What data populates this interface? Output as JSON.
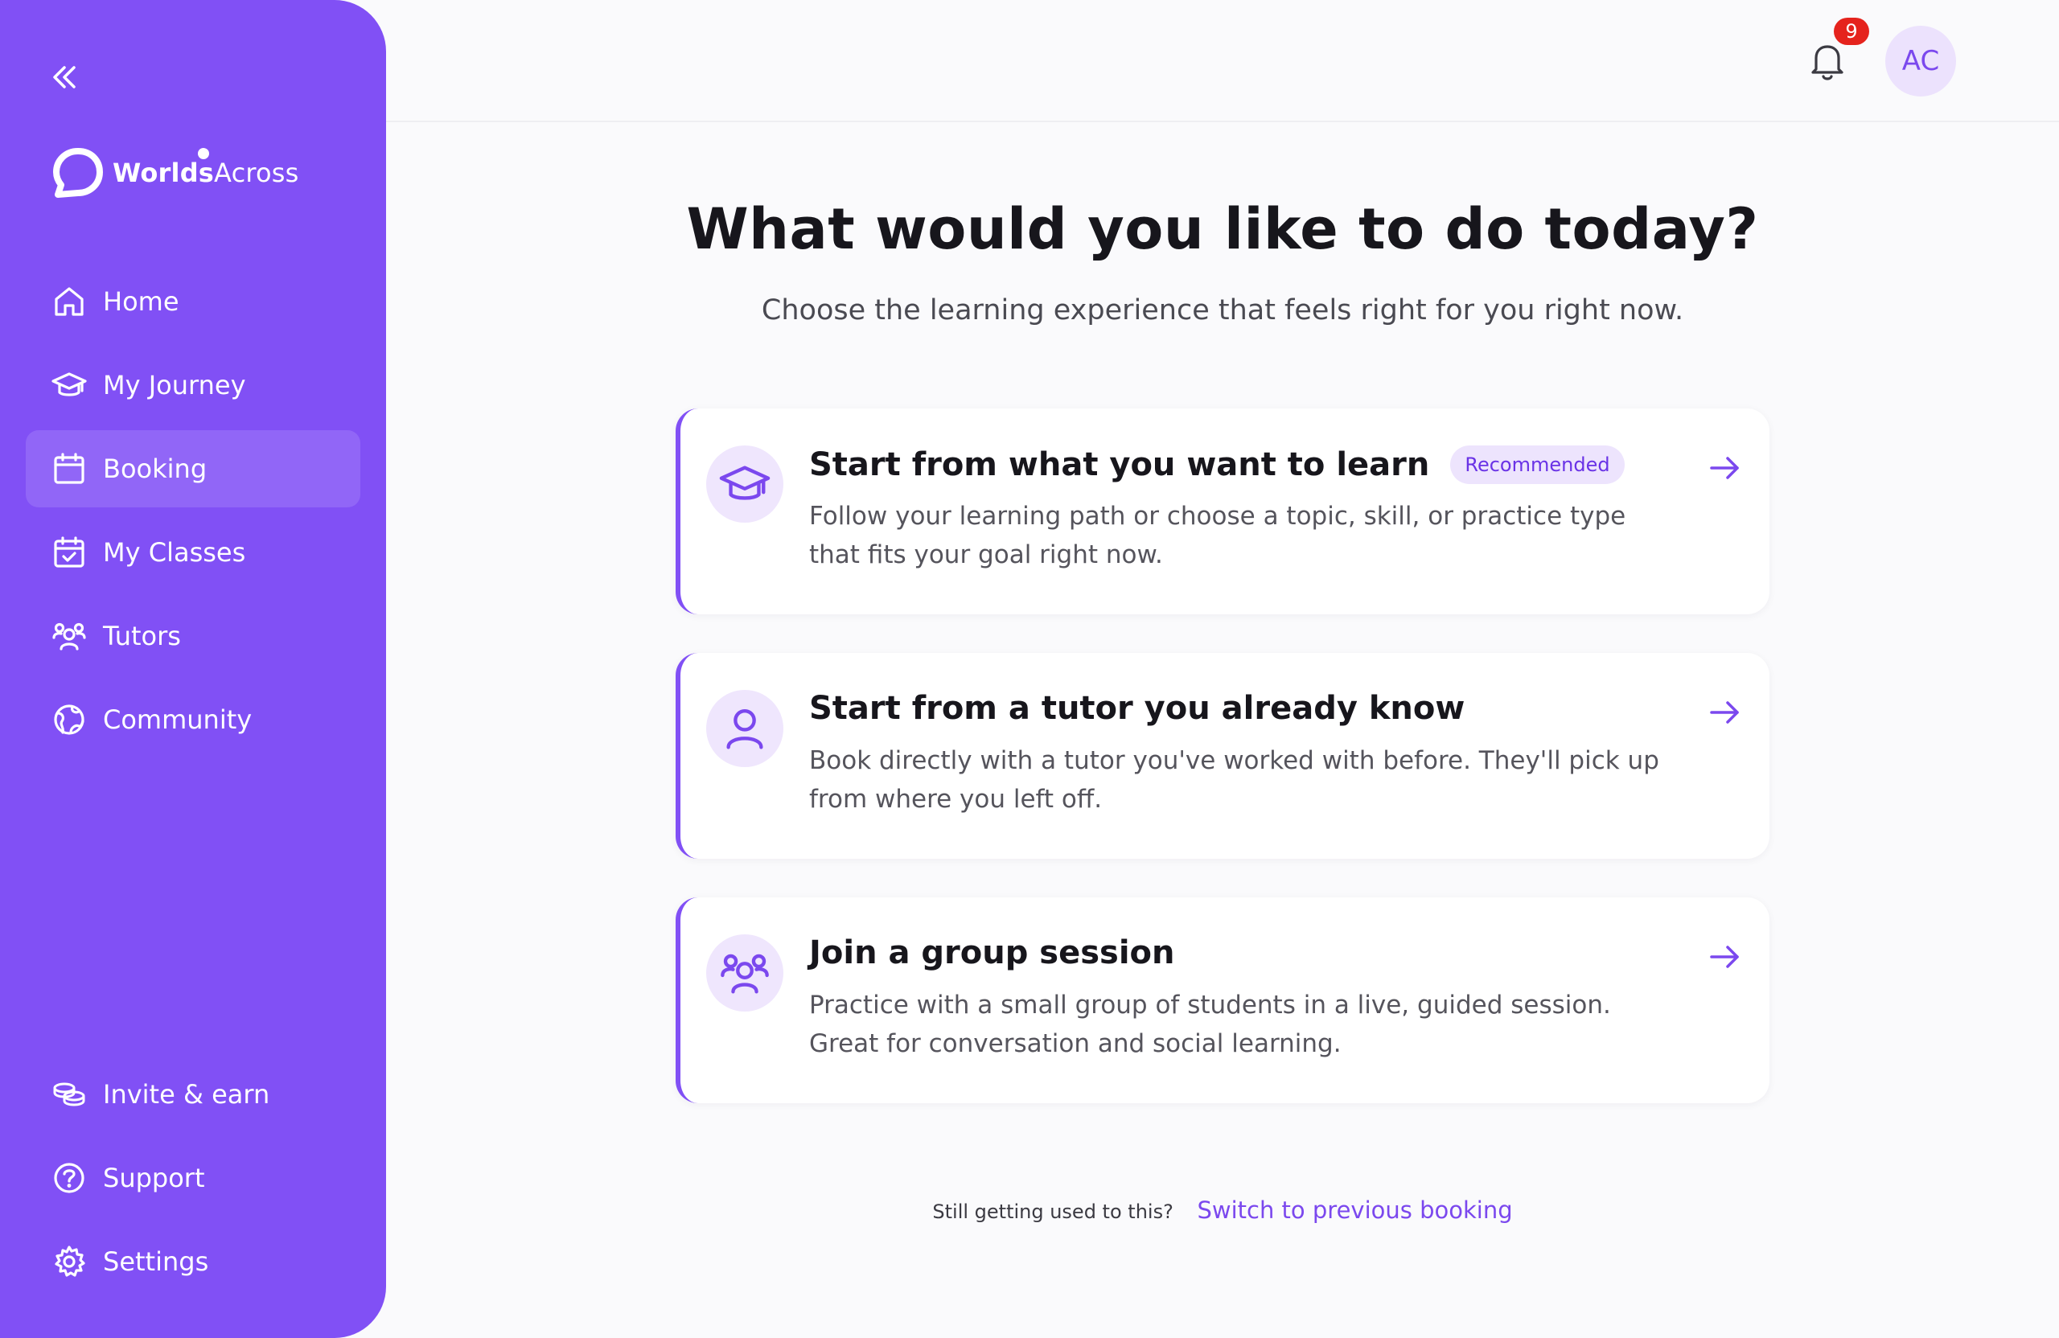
{
  "app": {
    "brand_bold": "Worlds",
    "brand_light": "Across",
    "accent_color": "#8150f5"
  },
  "sidebar": {
    "items": [
      {
        "label": "Home",
        "icon": "home-icon",
        "active": false
      },
      {
        "label": "My Journey",
        "icon": "graduation-cap-icon",
        "active": false
      },
      {
        "label": "Booking",
        "icon": "calendar-icon",
        "active": true
      },
      {
        "label": "My Classes",
        "icon": "calendar-check-icon",
        "active": false
      },
      {
        "label": "Tutors",
        "icon": "users-icon",
        "active": false
      },
      {
        "label": "Community",
        "icon": "globe-icon",
        "active": false
      }
    ],
    "bottom_items": [
      {
        "label": "Invite & earn",
        "icon": "coins-icon"
      },
      {
        "label": "Support",
        "icon": "help-circle-icon"
      },
      {
        "label": "Settings",
        "icon": "gear-icon"
      }
    ]
  },
  "header": {
    "notification_count": "9",
    "avatar_initials": "AC"
  },
  "main": {
    "title": "What would you like to do today?",
    "subtitle": "Choose the learning experience that feels right for you right now.",
    "cards": [
      {
        "title": "Start from what you want to learn",
        "badge": "Recommended",
        "description": "Follow your learning path or choose a topic, skill, or practice type that fits your goal right now.",
        "icon": "graduation-cap-icon"
      },
      {
        "title": "Start from a tutor you already know",
        "description": "Book directly with a tutor you've worked with before. They'll pick up from where you left off.",
        "icon": "user-icon"
      },
      {
        "title": "Join a group session",
        "description": "Practice with a small group of students in a live, guided session. Great for conversation and social learning.",
        "icon": "group-icon"
      }
    ],
    "footer_text": "Still getting used to this?",
    "footer_link": "Switch to previous booking"
  }
}
